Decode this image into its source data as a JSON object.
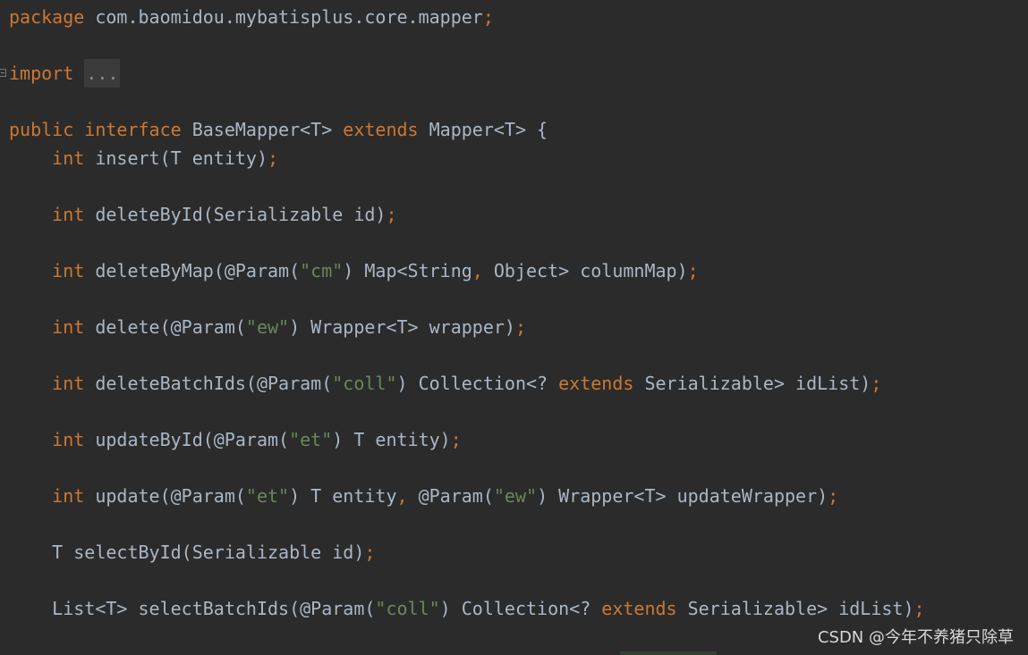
{
  "colors": {
    "background": "#2b2b2b",
    "keyword": "#cc7832",
    "identifier": "#a9b7c6",
    "string": "#6a8759"
  },
  "code": [
    [
      [
        "kw",
        "package"
      ],
      [
        "id",
        " com.baomidou.mybatisplus.core.mapper"
      ],
      [
        "kw",
        ";"
      ]
    ],
    [],
    [
      [
        "kw",
        "import"
      ],
      [
        "id",
        " "
      ],
      [
        "fold",
        "..."
      ]
    ],
    [],
    [
      [
        "kw",
        "public interface"
      ],
      [
        "id",
        " BaseMapper<T> "
      ],
      [
        "kw",
        "extends"
      ],
      [
        "id",
        " Mapper<T> {"
      ]
    ],
    [
      [
        "id",
        "    "
      ],
      [
        "kw",
        "int"
      ],
      [
        "id",
        " insert(T entity)"
      ],
      [
        "kw",
        ";"
      ]
    ],
    [],
    [
      [
        "id",
        "    "
      ],
      [
        "kw",
        "int"
      ],
      [
        "id",
        " deleteById(Serializable id)"
      ],
      [
        "kw",
        ";"
      ]
    ],
    [],
    [
      [
        "id",
        "    "
      ],
      [
        "kw",
        "int"
      ],
      [
        "id",
        " deleteByMap(@Param("
      ],
      [
        "str",
        "\"cm\""
      ],
      [
        "id",
        ") Map<String"
      ],
      [
        "kw",
        ","
      ],
      [
        "id",
        " Object> columnMap)"
      ],
      [
        "kw",
        ";"
      ]
    ],
    [],
    [
      [
        "id",
        "    "
      ],
      [
        "kw",
        "int"
      ],
      [
        "id",
        " delete(@Param("
      ],
      [
        "str",
        "\"ew\""
      ],
      [
        "id",
        ") Wrapper<T> wrapper)"
      ],
      [
        "kw",
        ";"
      ]
    ],
    [],
    [
      [
        "id",
        "    "
      ],
      [
        "kw",
        "int"
      ],
      [
        "id",
        " deleteBatchIds(@Param("
      ],
      [
        "str",
        "\"coll\""
      ],
      [
        "id",
        ") Collection<? "
      ],
      [
        "kw",
        "extends"
      ],
      [
        "id",
        " Serializable> idList)"
      ],
      [
        "kw",
        ";"
      ]
    ],
    [],
    [
      [
        "id",
        "    "
      ],
      [
        "kw",
        "int"
      ],
      [
        "id",
        " updateById(@Param("
      ],
      [
        "str",
        "\"et\""
      ],
      [
        "id",
        ") T entity)"
      ],
      [
        "kw",
        ";"
      ]
    ],
    [],
    [
      [
        "id",
        "    "
      ],
      [
        "kw",
        "int"
      ],
      [
        "id",
        " update(@Param("
      ],
      [
        "str",
        "\"et\""
      ],
      [
        "id",
        ") T entity"
      ],
      [
        "kw",
        ","
      ],
      [
        "id",
        " @Param("
      ],
      [
        "str",
        "\"ew\""
      ],
      [
        "id",
        ") Wrapper<T> updateWrapper)"
      ],
      [
        "kw",
        ";"
      ]
    ],
    [],
    [
      [
        "id",
        "    T selectById(Serializable id)"
      ],
      [
        "kw",
        ";"
      ]
    ],
    [],
    [
      [
        "id",
        "    List<T> selectBatchIds(@Param("
      ],
      [
        "str",
        "\"coll\""
      ],
      [
        "id",
        ") Collection<? "
      ],
      [
        "kw",
        "extends"
      ],
      [
        "id",
        " Serializable> idList)"
      ],
      [
        "kw",
        ";"
      ]
    ]
  ],
  "watermark": "CSDN @今年不养猪只除草"
}
